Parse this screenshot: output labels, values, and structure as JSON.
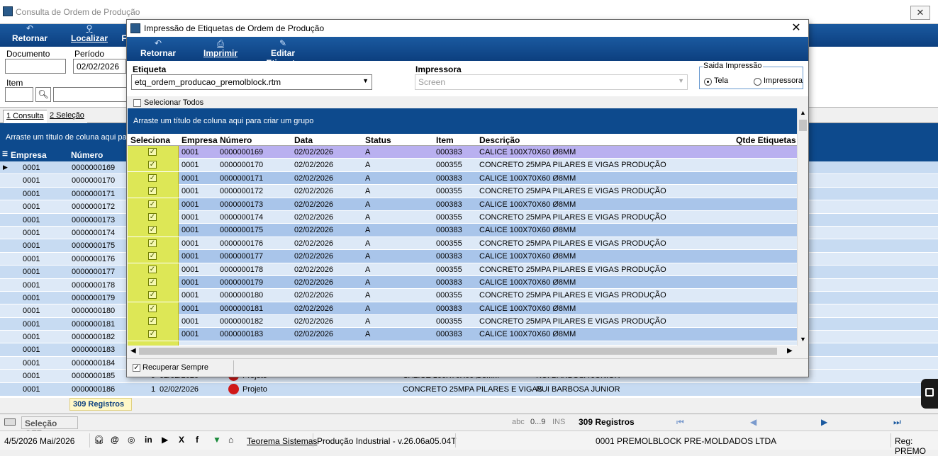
{
  "main": {
    "title": "Consulta de Ordem de Produção",
    "toolbar": {
      "retornar": "Retornar",
      "localizar": "Localizar",
      "f": "F"
    },
    "filters": {
      "documento_label": "Documento",
      "periodo_label": "Período",
      "periodo_value": "02/02/2026",
      "item_label": "Item"
    },
    "tabs": [
      "1 Consulta",
      "2 Seleção"
    ],
    "group_hint": "Arraste um título de coluna aqui para",
    "columns": {
      "empresa": "Empresa",
      "numero": "Número"
    },
    "rows": [
      {
        "empresa": "0001",
        "numero": "0000000169"
      },
      {
        "empresa": "0001",
        "numero": "0000000170"
      },
      {
        "empresa": "0001",
        "numero": "0000000171"
      },
      {
        "empresa": "0001",
        "numero": "0000000172"
      },
      {
        "empresa": "0001",
        "numero": "0000000173"
      },
      {
        "empresa": "0001",
        "numero": "0000000174"
      },
      {
        "empresa": "0001",
        "numero": "0000000175"
      },
      {
        "empresa": "0001",
        "numero": "0000000176"
      },
      {
        "empresa": "0001",
        "numero": "0000000177"
      },
      {
        "empresa": "0001",
        "numero": "0000000178"
      },
      {
        "empresa": "0001",
        "numero": "0000000179"
      },
      {
        "empresa": "0001",
        "numero": "0000000180"
      },
      {
        "empresa": "0001",
        "numero": "0000000181"
      },
      {
        "empresa": "0001",
        "numero": "0000000182"
      },
      {
        "empresa": "0001",
        "numero": "0000000183"
      },
      {
        "empresa": "0001",
        "numero": "0000000184"
      }
    ],
    "row185": {
      "empresa": "0001",
      "numero": "0000000185",
      "n": "9",
      "data": "02/02/2026",
      "status": "Projeto",
      "descricao": "CALICE 100X70X60 Ø8MM",
      "responsavel": "RUI BARBOSA JUNIOR"
    },
    "row186": {
      "empresa": "0001",
      "numero": "0000000186",
      "n": "1",
      "data": "02/02/2026",
      "status": "Projeto",
      "descricao": "CONCRETO 25MPA PILARES E VIGAS",
      "responsavel": "RUI BARBOSA JUNIOR"
    },
    "registros": "309 Registros",
    "statusbar": {
      "selecao": "Seleção OFF",
      "abc": "abc",
      "range": "0...9",
      "ins": "INS",
      "registros": "309 Registros"
    },
    "footer": {
      "date": "4/5/2026 Mai/2026",
      "teorema": "Teorema Sistemas",
      "version": "Produção Industrial - v.26.06a05.04T",
      "company": "0001 PREMOLBLOCK PRE-MOLDADOS LTDA",
      "reg": "Reg: PREMO"
    }
  },
  "dialog": {
    "title": "Impressão de Etiquetas de Ordem de Produção",
    "toolbar": {
      "retornar": "Retornar",
      "imprimir": "Imprimir",
      "editar": "Editar Etiqueta"
    },
    "etiqueta_label": "Etiqueta",
    "etiqueta_value": "etq_ordem_producao_premolblock.rtm",
    "impressora_label": "Impressora",
    "impressora_value": "Screen",
    "saida_label": "Saida Impressão",
    "saida_tela": "Tela",
    "saida_impressora": "Impressora",
    "selecionar_todos": "Selecionar Todos",
    "group_hint": "Arraste um título de coluna aqui para criar um grupo",
    "columns": {
      "seleciona": "Seleciona",
      "empresa": "Empresa",
      "numero": "Número",
      "data": "Data",
      "status": "Status",
      "item": "Item",
      "descricao": "Descrição",
      "qtde": "Qtde Etiquetas"
    },
    "rows": [
      {
        "empresa": "0001",
        "numero": "0000000169",
        "data": "02/02/2026",
        "status": "A",
        "item": "000383",
        "descricao": "CALICE 100X70X60 Ø8MM"
      },
      {
        "empresa": "0001",
        "numero": "0000000170",
        "data": "02/02/2026",
        "status": "A",
        "item": "000355",
        "descricao": "CONCRETO 25MPA PILARES E VIGAS PRODUÇÃO"
      },
      {
        "empresa": "0001",
        "numero": "0000000171",
        "data": "02/02/2026",
        "status": "A",
        "item": "000383",
        "descricao": "CALICE 100X70X60 Ø8MM"
      },
      {
        "empresa": "0001",
        "numero": "0000000172",
        "data": "02/02/2026",
        "status": "A",
        "item": "000355",
        "descricao": "CONCRETO 25MPA PILARES E VIGAS PRODUÇÃO"
      },
      {
        "empresa": "0001",
        "numero": "0000000173",
        "data": "02/02/2026",
        "status": "A",
        "item": "000383",
        "descricao": "CALICE 100X70X60 Ø8MM"
      },
      {
        "empresa": "0001",
        "numero": "0000000174",
        "data": "02/02/2026",
        "status": "A",
        "item": "000355",
        "descricao": "CONCRETO 25MPA PILARES E VIGAS PRODUÇÃO"
      },
      {
        "empresa": "0001",
        "numero": "0000000175",
        "data": "02/02/2026",
        "status": "A",
        "item": "000383",
        "descricao": "CALICE 100X70X60 Ø8MM"
      },
      {
        "empresa": "0001",
        "numero": "0000000176",
        "data": "02/02/2026",
        "status": "A",
        "item": "000355",
        "descricao": "CONCRETO 25MPA PILARES E VIGAS PRODUÇÃO"
      },
      {
        "empresa": "0001",
        "numero": "0000000177",
        "data": "02/02/2026",
        "status": "A",
        "item": "000383",
        "descricao": "CALICE 100X70X60 Ø8MM"
      },
      {
        "empresa": "0001",
        "numero": "0000000178",
        "data": "02/02/2026",
        "status": "A",
        "item": "000355",
        "descricao": "CONCRETO 25MPA PILARES E VIGAS PRODUÇÃO"
      },
      {
        "empresa": "0001",
        "numero": "0000000179",
        "data": "02/02/2026",
        "status": "A",
        "item": "000383",
        "descricao": "CALICE 100X70X60 Ø8MM"
      },
      {
        "empresa": "0001",
        "numero": "0000000180",
        "data": "02/02/2026",
        "status": "A",
        "item": "000355",
        "descricao": "CONCRETO 25MPA PILARES E VIGAS PRODUÇÃO"
      },
      {
        "empresa": "0001",
        "numero": "0000000181",
        "data": "02/02/2026",
        "status": "A",
        "item": "000383",
        "descricao": "CALICE 100X70X60 Ø8MM"
      },
      {
        "empresa": "0001",
        "numero": "0000000182",
        "data": "02/02/2026",
        "status": "A",
        "item": "000355",
        "descricao": "CONCRETO 25MPA PILARES E VIGAS PRODUÇÃO"
      },
      {
        "empresa": "0001",
        "numero": "0000000183",
        "data": "02/02/2026",
        "status": "A",
        "item": "000383",
        "descricao": "CALICE 100X70X60 Ø8MM"
      }
    ],
    "recuperar": "Recuperar Sempre"
  }
}
